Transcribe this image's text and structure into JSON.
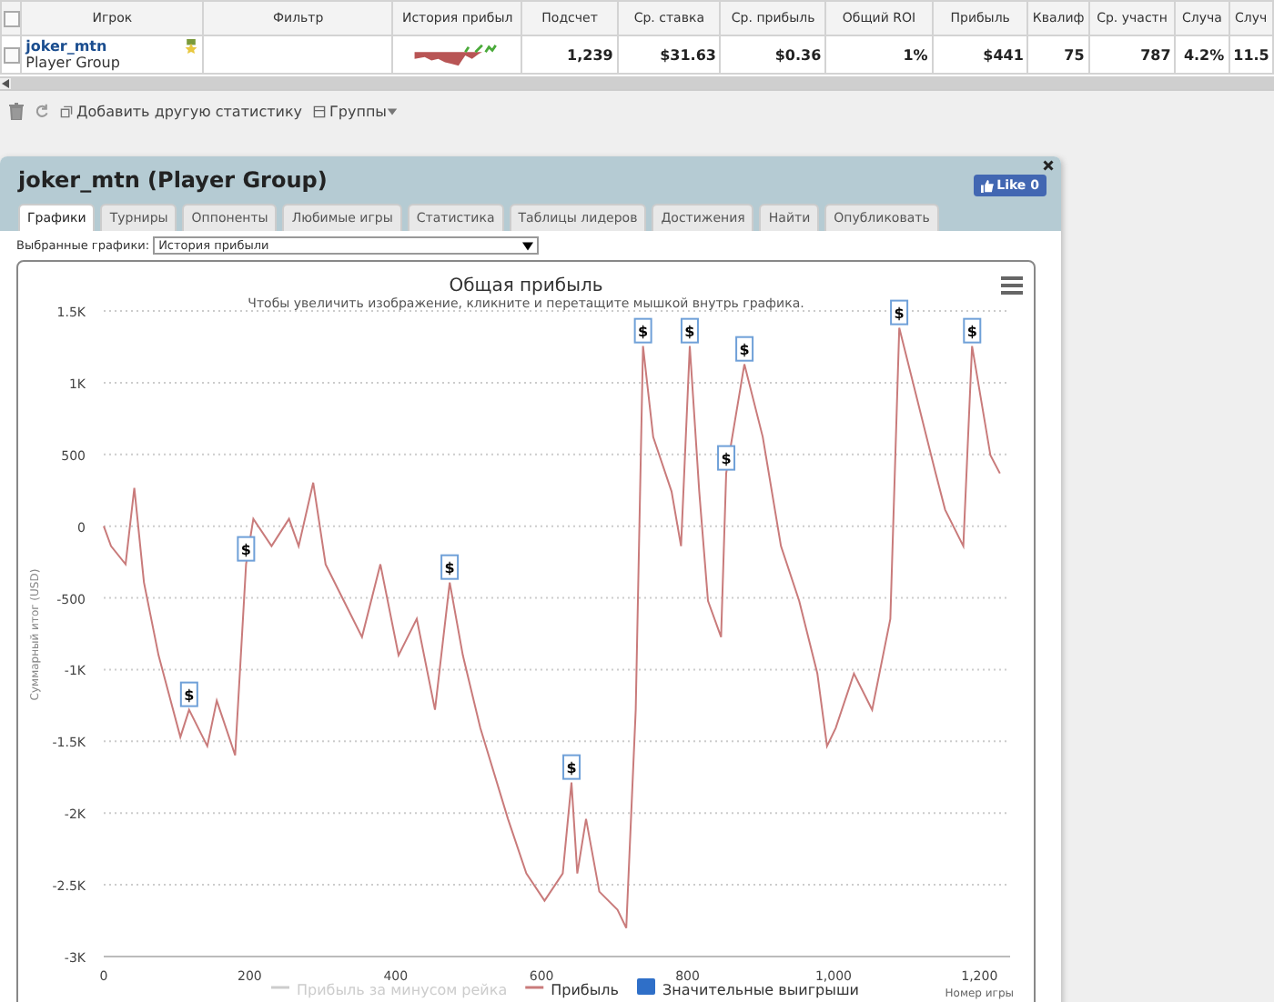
{
  "grid": {
    "columns": [
      "Игрок",
      "Фильтр",
      "История прибыл",
      "Подсчет",
      "Ср. ставка",
      "Ср. прибыль",
      "Общий ROI",
      "Прибыль",
      "Квалиф",
      "Ср. участн",
      "Случа",
      "Случ"
    ],
    "all_checked": false,
    "rows": [
      {
        "checked": false,
        "cells": [
          {
            "name": "joker_mtn",
            "group": "Player Group"
          },
          "",
          null,
          "1,239",
          "$31.63",
          "$0.36",
          "1%",
          "$441",
          "75",
          "787",
          "4.2%",
          "11.5"
        ]
      }
    ]
  },
  "toolbar": {
    "add_stat": "Добавить другую статистику",
    "groups": "Группы"
  },
  "panel": {
    "title": "joker_mtn (Player Group)",
    "like": "Like 0",
    "tabs": [
      {
        "label": "Графики",
        "selected": true
      },
      {
        "label": "Турниры",
        "selected": false
      },
      {
        "label": "Оппоненты",
        "selected": false
      },
      {
        "label": "Любимые игры",
        "selected": false
      },
      {
        "label": "Статистика",
        "selected": false
      },
      {
        "label": "Таблицы лидеров",
        "selected": false
      },
      {
        "label": "Достижения",
        "selected": false
      },
      {
        "label": "Найти",
        "selected": false
      },
      {
        "label": "Опубликовать",
        "selected": false
      }
    ],
    "chart_select_label": "Выбранные графики:",
    "chart_select_value": "История прибыли",
    "chart": {
      "subtitle": "Чтобы увеличить изображение, кликните и перетащите мышкой внутрь графика.",
      "legend": [
        {
          "label": "Прибыль за минусом рейка",
          "visible": false,
          "kind": "line"
        },
        {
          "visible": true,
          "kind": "series"
        },
        {
          "label": "Значительные выигрыши",
          "visible": true,
          "kind": "flag"
        }
      ],
      "chart_data": {
        "type": "line",
        "title": "Общая прибыль",
        "xlabel": "Номер игры",
        "ylabel": "Суммарный итог (USD)",
        "grid": true,
        "xlim": [
          0,
          1242
        ],
        "ylim": [
          -3000,
          1500
        ],
        "xticks": [
          0,
          200,
          400,
          600,
          800,
          {
            "value": 1000,
            "label": "1,000"
          },
          {
            "value": 1200,
            "label": "1,200"
          }
        ],
        "yticks": [
          {
            "value": 1500,
            "label": "1.5K"
          },
          {
            "value": 1000,
            "label": "1K"
          },
          500,
          0,
          -500,
          {
            "value": -1000,
            "label": "-1K"
          },
          {
            "value": -1500,
            "label": "-1.5K"
          },
          {
            "value": -2000,
            "label": "-2K"
          },
          {
            "value": -2500,
            "label": "-2.5K"
          },
          {
            "value": -3000,
            "label": "-3K"
          }
        ],
        "x": [
          0,
          10,
          30,
          42,
          55,
          75,
          105,
          117,
          142,
          155,
          180,
          195,
          205,
          230,
          254,
          267,
          287,
          304,
          329,
          354,
          379,
          404,
          429,
          454,
          474,
          492,
          516,
          554,
          579,
          604,
          629,
          641,
          649,
          661,
          679,
          704,
          716,
          729,
          739,
          753,
          778,
          791,
          803,
          816,
          828,
          846,
          853,
          878,
          903,
          928,
          953,
          978,
          991,
          1003,
          1028,
          1053,
          1078,
          1090,
          1115,
          1140,
          1153,
          1178,
          1190,
          1215,
          1228
        ],
        "series": [
          {
            "name": "Прибыль",
            "color": "#c97b7b",
            "values": [
              0,
              -139,
              -266,
              266,
              -393,
              -900,
              -1470,
              -1280,
              -1533,
              -1217,
              -1597,
              -266,
              51,
              -139,
              51,
              -139,
              304,
              -266,
              -520,
              -773,
              -266,
              -900,
              -646,
              -1280,
              -393,
              -900,
              -1407,
              -2041,
              -2421,
              -2611,
              -2421,
              -1787,
              -2421,
              -2041,
              -2548,
              -2674,
              -2801,
              -1280,
              1255,
              621,
              241,
              -139,
              1255,
              241,
              -520,
              -773,
              368,
              1128,
              621,
              -139,
              -520,
              -1027,
              -1534,
              -1407,
              -1027,
              -1280,
              -646,
              1382,
              875,
              368,
              114,
              -139,
              1255,
              494,
              368
            ]
          }
        ],
        "annotations": [
          {
            "x": 117,
            "y": -1280,
            "text": "$"
          },
          {
            "x": 195,
            "y": -266,
            "text": "$"
          },
          {
            "x": 474,
            "y": -393,
            "text": "$"
          },
          {
            "x": 641,
            "y": -1787,
            "text": "$"
          },
          {
            "x": 739,
            "y": 1255,
            "text": "$"
          },
          {
            "x": 803,
            "y": 1255,
            "text": "$"
          },
          {
            "x": 853,
            "y": 368,
            "text": "$"
          },
          {
            "x": 878,
            "y": 1128,
            "text": "$"
          },
          {
            "x": 1090,
            "y": 1382,
            "text": "$"
          },
          {
            "x": 1190,
            "y": 1255,
            "text": "$"
          }
        ]
      }
    }
  }
}
